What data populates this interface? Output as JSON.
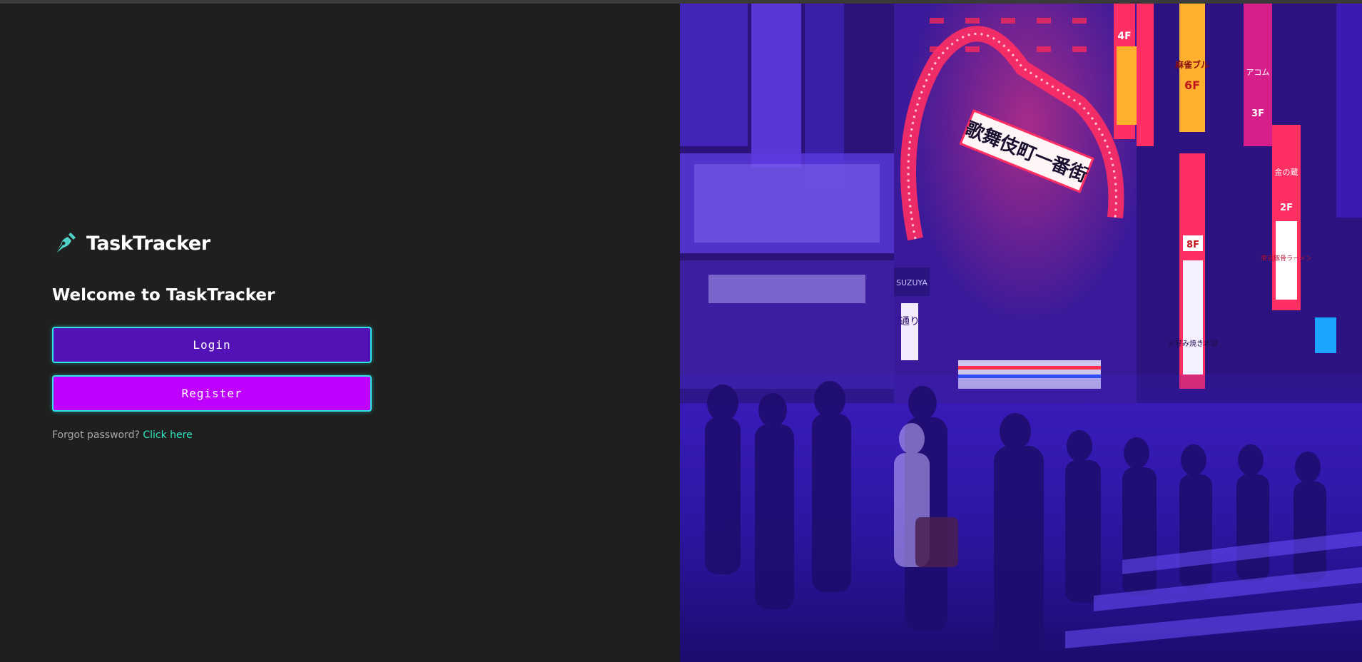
{
  "app": {
    "name": "TaskTracker",
    "welcome": "Welcome to TaskTracker"
  },
  "buttons": {
    "login": "Login",
    "register": "Register"
  },
  "forgot": {
    "text": "Forgot password?",
    "link": "Click here"
  },
  "hero_image": {
    "description_icon": "city-street-photo",
    "signs": {
      "arch": "歌舞伎町一番街",
      "left_sign": "通り",
      "right_sign": "お好み焼き本舗",
      "floor_a": "4F",
      "floor_b": "6F",
      "floor_c": "8F",
      "floor_d": "2F",
      "floor_e": "3F",
      "sign_a": "麻雀ブル",
      "sign_b": "アコム",
      "sign_c": "金の蔵",
      "sign_d": "東京豚骨ラーメン",
      "sign_e": "SUZUYA"
    }
  },
  "colors": {
    "background": "#1f1f1f",
    "login_button": "#5312b5",
    "register_button": "#bf00ff",
    "button_border": "#2ee6e6",
    "link": "#2ee6c0"
  }
}
